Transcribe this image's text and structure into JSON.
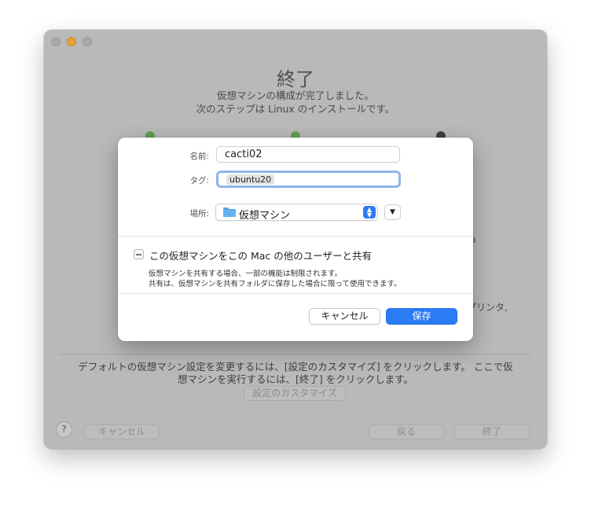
{
  "window": {
    "title": "終了",
    "subtitle_line1": "仮想マシンの構成が完了しました。",
    "subtitle_line2": "次のステップは Linux のインストールです。",
    "bg_fragment_right1": "o",
    "bg_fragment_right2": "プリンタ,",
    "footer_line1": "デフォルトの仮想マシン設定を変更するには、[設定のカスタマイズ] をクリックします。 ここで仮",
    "footer_line2": "想マシンを実行するには、[終了] をクリックします。",
    "customize_label": "設定のカスタマイズ",
    "help_label": "?",
    "cancel_label": "キャンセル",
    "back_label": "戻る",
    "finish_label": "終了"
  },
  "sheet": {
    "name_label": "名前:",
    "name_value": "cacti02",
    "tags_label": "タグ:",
    "tag_value": "ubuntu20",
    "location_label": "場所:",
    "location_value": "仮想マシン",
    "share_label": "この仮想マシンをこの Mac の他のユーザーと共有",
    "share_desc_line1": "仮想マシンを共有する場合、一部の機能は制限されます。",
    "share_desc_line2": "共有は、仮想マシンを共有フォルダに保存した場合に限って使用できます。",
    "cancel_label": "キャンセル",
    "save_label": "保存"
  },
  "icons": {
    "folder": "folder-icon",
    "stepper": "up-down-chevron-icon",
    "disclosure": "chevron-down-icon"
  },
  "colors": {
    "accent": "#2a7cf5",
    "step_complete": "#5f9f4f",
    "step_current": "#3e3e3e"
  }
}
